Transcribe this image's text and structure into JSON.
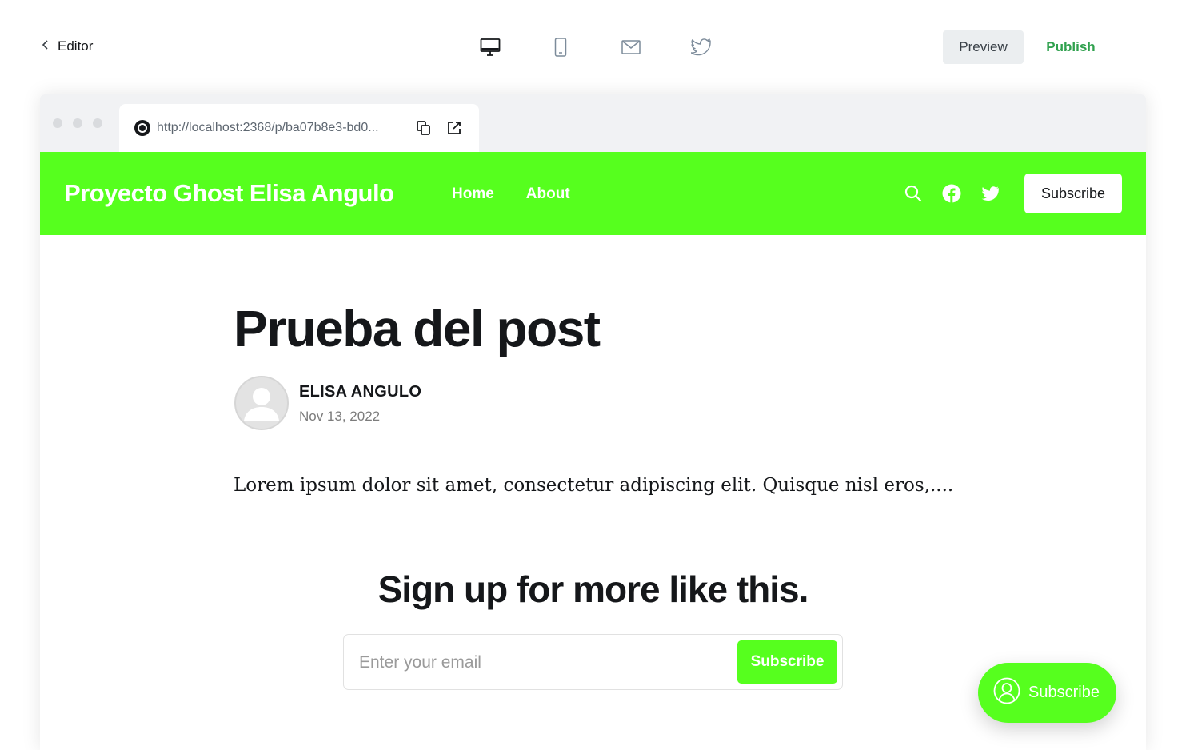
{
  "editor": {
    "back_label": "Editor",
    "devices": [
      "desktop-icon",
      "mobile-icon",
      "email-icon",
      "twitter-icon"
    ],
    "preview_label": "Preview",
    "publish_label": "Publish"
  },
  "browser": {
    "url": "http://localhost:2368/p/ba07b8e3-bd0..."
  },
  "site": {
    "title": "Proyecto Ghost Elisa Angulo",
    "nav": [
      "Home",
      "About"
    ],
    "subscribe_label": "Subscribe",
    "accent": "#56ff1e"
  },
  "post": {
    "title": "Prueba del post",
    "author": "ELISA ANGULO",
    "date": "Nov 13, 2022",
    "excerpt": "Lorem ipsum dolor sit amet, consectetur adipiscing elit. Quisque nisl eros,...."
  },
  "signup": {
    "heading": "Sign up for more like this.",
    "placeholder": "Enter your email",
    "button_label": "Subscribe"
  },
  "portal": {
    "label": "Subscribe"
  }
}
